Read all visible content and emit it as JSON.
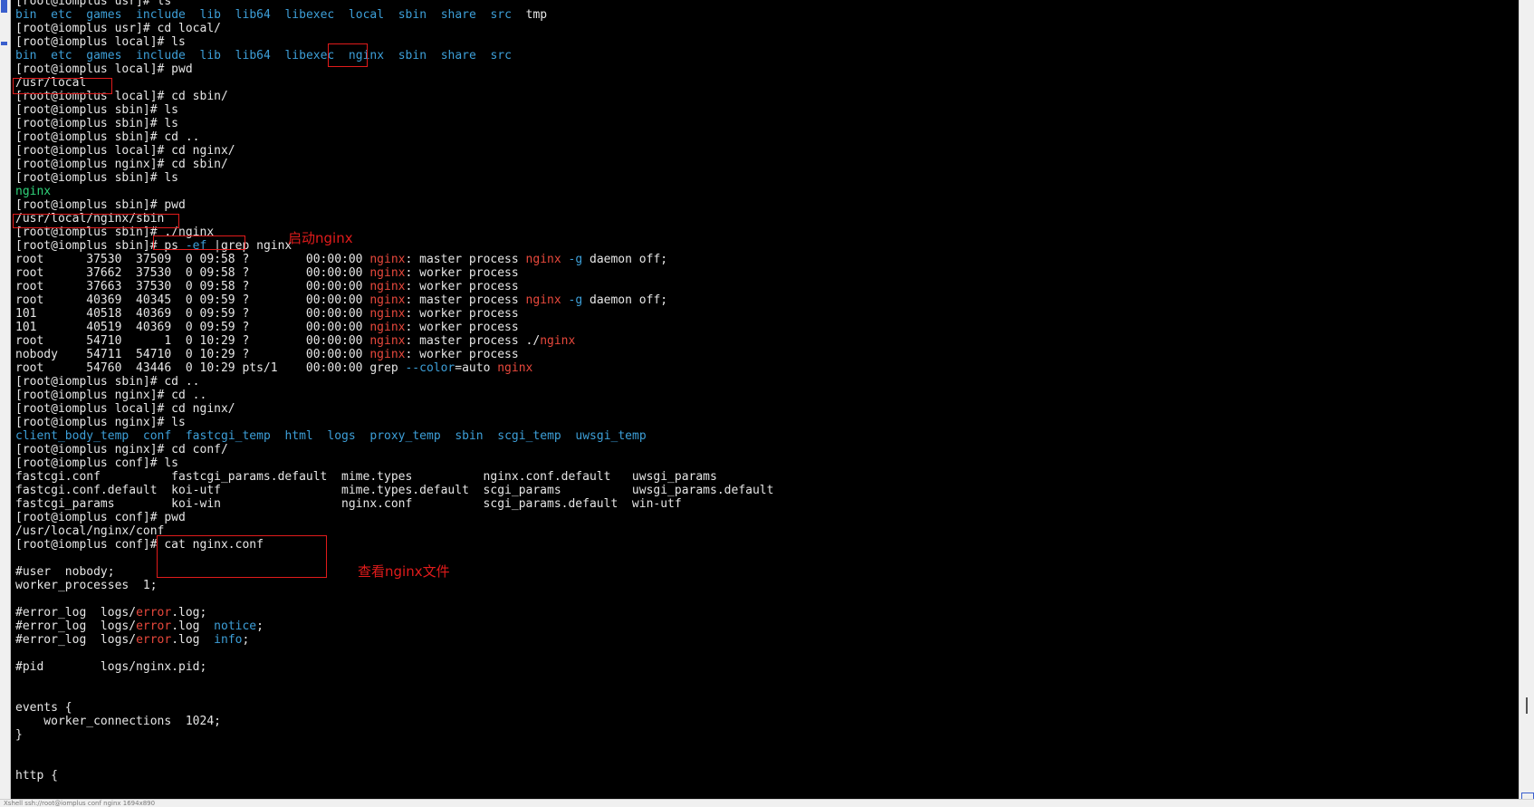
{
  "colors": {
    "background": "#000000",
    "text": "#e6e6e6",
    "directory": "#3d9fd8",
    "executable": "#2fd37a",
    "grep_match": "#e8483c",
    "annotation": "#e11b1b"
  },
  "terminal": {
    "lines": [
      [
        {
          "t": "[root@iomplus usr]# ls"
        }
      ],
      [
        {
          "t": "bin",
          "c": "cyan"
        },
        {
          "t": "  "
        },
        {
          "t": "etc",
          "c": "cyan"
        },
        {
          "t": "  "
        },
        {
          "t": "games",
          "c": "cyan"
        },
        {
          "t": "  "
        },
        {
          "t": "include",
          "c": "cyan"
        },
        {
          "t": "  "
        },
        {
          "t": "lib",
          "c": "cyan"
        },
        {
          "t": "  "
        },
        {
          "t": "lib64",
          "c": "cyan"
        },
        {
          "t": "  "
        },
        {
          "t": "libexec",
          "c": "cyan"
        },
        {
          "t": "  "
        },
        {
          "t": "local",
          "c": "cyan"
        },
        {
          "t": "  "
        },
        {
          "t": "sbin",
          "c": "cyan"
        },
        {
          "t": "  "
        },
        {
          "t": "share",
          "c": "cyan"
        },
        {
          "t": "  "
        },
        {
          "t": "src",
          "c": "cyan"
        },
        {
          "t": "  tmp"
        }
      ],
      [
        {
          "t": "[root@iomplus usr]# cd local/"
        }
      ],
      [
        {
          "t": "[root@iomplus local]# ls"
        }
      ],
      [
        {
          "t": "bin",
          "c": "cyan"
        },
        {
          "t": "  "
        },
        {
          "t": "etc",
          "c": "cyan"
        },
        {
          "t": "  "
        },
        {
          "t": "games",
          "c": "cyan"
        },
        {
          "t": "  "
        },
        {
          "t": "include",
          "c": "cyan"
        },
        {
          "t": "  "
        },
        {
          "t": "lib",
          "c": "cyan"
        },
        {
          "t": "  "
        },
        {
          "t": "lib64",
          "c": "cyan"
        },
        {
          "t": "  "
        },
        {
          "t": "libexec",
          "c": "cyan"
        },
        {
          "t": "  "
        },
        {
          "t": "nginx",
          "c": "cyan"
        },
        {
          "t": "  "
        },
        {
          "t": "sbin",
          "c": "cyan"
        },
        {
          "t": "  "
        },
        {
          "t": "share",
          "c": "cyan"
        },
        {
          "t": "  "
        },
        {
          "t": "src",
          "c": "cyan"
        }
      ],
      [
        {
          "t": "[root@iomplus local]# pwd"
        }
      ],
      [
        {
          "t": "/usr/local"
        }
      ],
      [
        {
          "t": "[root@iomplus local]# cd sbin/"
        }
      ],
      [
        {
          "t": "[root@iomplus sbin]# ls"
        }
      ],
      [
        {
          "t": "[root@iomplus sbin]# ls"
        }
      ],
      [
        {
          "t": "[root@iomplus sbin]# cd .."
        }
      ],
      [
        {
          "t": "[root@iomplus local]# cd nginx/"
        }
      ],
      [
        {
          "t": "[root@iomplus nginx]# cd sbin/"
        }
      ],
      [
        {
          "t": "[root@iomplus sbin]# ls"
        }
      ],
      [
        {
          "t": "nginx",
          "c": "green"
        }
      ],
      [
        {
          "t": "[root@iomplus sbin]# pwd"
        }
      ],
      [
        {
          "t": "/usr/local/nginx/sbin"
        }
      ],
      [
        {
          "t": "[root@iomplus sbin]# ./nginx"
        }
      ],
      [
        {
          "t": "[root@iomplus sbin]# ps "
        },
        {
          "t": "-ef",
          "c": "blue"
        },
        {
          "t": " |grep nginx"
        }
      ],
      [
        {
          "t": "root      37530  37509  0 09:58 ?        00:00:00 "
        },
        {
          "t": "nginx",
          "c": "red"
        },
        {
          "t": ": master process "
        },
        {
          "t": "nginx",
          "c": "red"
        },
        {
          "t": " "
        },
        {
          "t": "-g",
          "c": "blue"
        },
        {
          "t": " daemon off;"
        }
      ],
      [
        {
          "t": "root      37662  37530  0 09:58 ?        00:00:00 "
        },
        {
          "t": "nginx",
          "c": "red"
        },
        {
          "t": ": worker process"
        }
      ],
      [
        {
          "t": "root      37663  37530  0 09:58 ?        00:00:00 "
        },
        {
          "t": "nginx",
          "c": "red"
        },
        {
          "t": ": worker process"
        }
      ],
      [
        {
          "t": "root      40369  40345  0 09:59 ?        00:00:00 "
        },
        {
          "t": "nginx",
          "c": "red"
        },
        {
          "t": ": master process "
        },
        {
          "t": "nginx",
          "c": "red"
        },
        {
          "t": " "
        },
        {
          "t": "-g",
          "c": "blue"
        },
        {
          "t": " daemon off;"
        }
      ],
      [
        {
          "t": "101       40518  40369  0 09:59 ?        00:00:00 "
        },
        {
          "t": "nginx",
          "c": "red"
        },
        {
          "t": ": worker process"
        }
      ],
      [
        {
          "t": "101       40519  40369  0 09:59 ?        00:00:00 "
        },
        {
          "t": "nginx",
          "c": "red"
        },
        {
          "t": ": worker process"
        }
      ],
      [
        {
          "t": "root      54710      1  0 10:29 ?        00:00:00 "
        },
        {
          "t": "nginx",
          "c": "red"
        },
        {
          "t": ": master process ./"
        },
        {
          "t": "nginx",
          "c": "red"
        }
      ],
      [
        {
          "t": "nobody    54711  54710  0 10:29 ?        00:00:00 "
        },
        {
          "t": "nginx",
          "c": "red"
        },
        {
          "t": ": worker process"
        }
      ],
      [
        {
          "t": "root      54760  43446  0 10:29 pts/1    00:00:00 grep "
        },
        {
          "t": "--color",
          "c": "blue"
        },
        {
          "t": "=auto "
        },
        {
          "t": "nginx",
          "c": "red"
        }
      ],
      [
        {
          "t": "[root@iomplus sbin]# cd .."
        }
      ],
      [
        {
          "t": "[root@iomplus nginx]# cd .."
        }
      ],
      [
        {
          "t": "[root@iomplus local]# cd nginx/"
        }
      ],
      [
        {
          "t": "[root@iomplus nginx]# ls"
        }
      ],
      [
        {
          "t": "client_body_temp",
          "c": "cyan"
        },
        {
          "t": "  "
        },
        {
          "t": "conf",
          "c": "cyan"
        },
        {
          "t": "  "
        },
        {
          "t": "fastcgi_temp",
          "c": "cyan"
        },
        {
          "t": "  "
        },
        {
          "t": "html",
          "c": "cyan"
        },
        {
          "t": "  "
        },
        {
          "t": "logs",
          "c": "cyan"
        },
        {
          "t": "  "
        },
        {
          "t": "proxy_temp",
          "c": "cyan"
        },
        {
          "t": "  "
        },
        {
          "t": "sbin",
          "c": "cyan"
        },
        {
          "t": "  "
        },
        {
          "t": "scgi_temp",
          "c": "cyan"
        },
        {
          "t": "  "
        },
        {
          "t": "uwsgi_temp",
          "c": "cyan"
        }
      ],
      [
        {
          "t": "[root@iomplus nginx]# cd conf/"
        }
      ],
      [
        {
          "t": "[root@iomplus conf]# ls"
        }
      ],
      [
        {
          "t": "fastcgi.conf          fastcgi_params.default  mime.types          nginx.conf.default   uwsgi_params"
        }
      ],
      [
        {
          "t": "fastcgi.conf.default  koi-utf                 mime.types.default  scgi_params          uwsgi_params.default"
        }
      ],
      [
        {
          "t": "fastcgi_params        koi-win                 nginx.conf          scgi_params.default  win-utf"
        }
      ],
      [
        {
          "t": "[root@iomplus conf]# pwd"
        }
      ],
      [
        {
          "t": "/usr/local/nginx/conf"
        }
      ],
      [
        {
          "t": "[root@iomplus conf]# cat nginx.conf"
        }
      ],
      [
        {
          "t": ""
        }
      ],
      [
        {
          "t": "#user  nobody;"
        }
      ],
      [
        {
          "t": "worker_processes  1;"
        }
      ],
      [
        {
          "t": ""
        }
      ],
      [
        {
          "t": "#error_log  logs/"
        },
        {
          "t": "error",
          "c": "red"
        },
        {
          "t": ".log;"
        }
      ],
      [
        {
          "t": "#error_log  logs/"
        },
        {
          "t": "error",
          "c": "red"
        },
        {
          "t": ".log  "
        },
        {
          "t": "notice",
          "c": "blue"
        },
        {
          "t": ";"
        }
      ],
      [
        {
          "t": "#error_log  logs/"
        },
        {
          "t": "error",
          "c": "red"
        },
        {
          "t": ".log  "
        },
        {
          "t": "info",
          "c": "blue"
        },
        {
          "t": ";"
        }
      ],
      [
        {
          "t": ""
        }
      ],
      [
        {
          "t": "#pid        logs/nginx.pid;"
        }
      ],
      [
        {
          "t": ""
        }
      ],
      [
        {
          "t": ""
        }
      ],
      [
        {
          "t": "events {"
        }
      ],
      [
        {
          "t": "    worker_connections  1024;"
        }
      ],
      [
        {
          "t": "}"
        }
      ],
      [
        {
          "t": ""
        }
      ],
      [
        {
          "t": ""
        }
      ],
      [
        {
          "t": "http {"
        }
      ]
    ]
  },
  "annotations": {
    "start_nginx": "启动nginx",
    "view_nginx_file": "查看nginx文件"
  },
  "status_bar": {
    "text": "Xshell  ssh://root@iomplus  conf  nginx  1694x890"
  }
}
